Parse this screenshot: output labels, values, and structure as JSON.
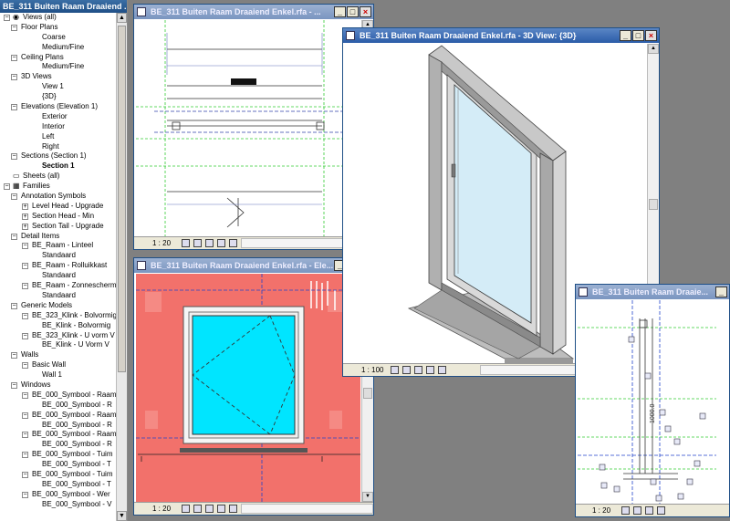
{
  "project_browser": {
    "title": "BE_311 Buiten Raam Draaiend ...",
    "items": [
      {
        "label": "Views (all)",
        "level": 0,
        "expander": "−",
        "icon": "eye-icon"
      },
      {
        "label": "Floor Plans",
        "level": 1,
        "expander": "−"
      },
      {
        "label": "Coarse",
        "level": 3
      },
      {
        "label": "Medium/Fine",
        "level": 3
      },
      {
        "label": "Ceiling Plans",
        "level": 1,
        "expander": "−"
      },
      {
        "label": "Medium/Fine",
        "level": 3
      },
      {
        "label": "3D Views",
        "level": 1,
        "expander": "−"
      },
      {
        "label": "View 1",
        "level": 3
      },
      {
        "label": "{3D}",
        "level": 3
      },
      {
        "label": "Elevations (Elevation 1)",
        "level": 1,
        "expander": "−"
      },
      {
        "label": "Exterior",
        "level": 3
      },
      {
        "label": "Interior",
        "level": 3
      },
      {
        "label": "Left",
        "level": 3
      },
      {
        "label": "Right",
        "level": 3
      },
      {
        "label": "Sections (Section 1)",
        "level": 1,
        "expander": "−"
      },
      {
        "label": "Section 1",
        "level": 3,
        "bold": true
      },
      {
        "label": "Sheets (all)",
        "level": 0,
        "icon": "sheet-icon"
      },
      {
        "label": "Families",
        "level": 0,
        "expander": "−",
        "icon": "family-icon"
      },
      {
        "label": "Annotation Symbols",
        "level": 1,
        "expander": "−"
      },
      {
        "label": "Level Head - Upgrade",
        "level": 2,
        "expander": "+"
      },
      {
        "label": "Section Head - Min",
        "level": 2,
        "expander": "+"
      },
      {
        "label": "Section Tail - Upgrade",
        "level": 2,
        "expander": "+"
      },
      {
        "label": "Detail Items",
        "level": 1,
        "expander": "−"
      },
      {
        "label": "BE_Raam - Linteel",
        "level": 2,
        "expander": "−"
      },
      {
        "label": "Standaard",
        "level": 3
      },
      {
        "label": "BE_Raam - Rolluikkast",
        "level": 2,
        "expander": "−"
      },
      {
        "label": "Standaard",
        "level": 3
      },
      {
        "label": "BE_Raam - Zonnescherm",
        "level": 2,
        "expander": "−"
      },
      {
        "label": "Standaard",
        "level": 3
      },
      {
        "label": "Generic Models",
        "level": 1,
        "expander": "−"
      },
      {
        "label": "BE_323_Klink - Bolvormig",
        "level": 2,
        "expander": "−"
      },
      {
        "label": "BE_Klink - Bolvormig",
        "level": 3
      },
      {
        "label": "BE_323_Klink - U vorm V",
        "level": 2,
        "expander": "−"
      },
      {
        "label": "BE_Klink - U Vorm V",
        "level": 3
      },
      {
        "label": "Walls",
        "level": 1,
        "expander": "−"
      },
      {
        "label": "Basic Wall",
        "level": 2,
        "expander": "−"
      },
      {
        "label": "Wall 1",
        "level": 3
      },
      {
        "label": "Windows",
        "level": 1,
        "expander": "−"
      },
      {
        "label": "BE_000_Symbool - Raam",
        "level": 2,
        "expander": "−"
      },
      {
        "label": "BE_000_Symbool - R",
        "level": 3
      },
      {
        "label": "BE_000_Symbool - Raam",
        "level": 2,
        "expander": "−"
      },
      {
        "label": "BE_000_Symbool - R",
        "level": 3
      },
      {
        "label": "BE_000_Symbool - Raam",
        "level": 2,
        "expander": "−"
      },
      {
        "label": "BE_000_Symbool - R",
        "level": 3
      },
      {
        "label": "BE_000_Symbool - Tuim",
        "level": 2,
        "expander": "−"
      },
      {
        "label": "BE_000_Symbool - T",
        "level": 3
      },
      {
        "label": "BE_000_Symbool - Tuim",
        "level": 2,
        "expander": "−"
      },
      {
        "label": "BE_000_Symbool - T",
        "level": 3
      },
      {
        "label": "BE_000_Symbool - Wer",
        "level": 2,
        "expander": "−"
      },
      {
        "label": "BE_000_Symbool - V",
        "level": 3
      }
    ]
  },
  "windows": {
    "plan": {
      "title": "BE_311 Buiten Raam Draaiend Enkel.rfa - ...",
      "scale": "1 : 20"
    },
    "view3d": {
      "title": "BE_311 Buiten Raam Draaiend Enkel.rfa - 3D View: {3D}",
      "scale": "1 : 100"
    },
    "elevation": {
      "title": "BE_311 Buiten Raam Draaiend Enkel.rfa - Ele...",
      "scale": "1 : 20"
    },
    "section": {
      "title": "BE_311 Buiten Raam Draaie...",
      "scale": "1 : 20",
      "dimension": "1000.0"
    }
  },
  "colors": {
    "titlebar_active": "#2a5ca8",
    "workspace": "#808080",
    "elevation_bg": "#f2716b",
    "glass": "#00e5ff",
    "ref_plane": "#33cc33"
  }
}
